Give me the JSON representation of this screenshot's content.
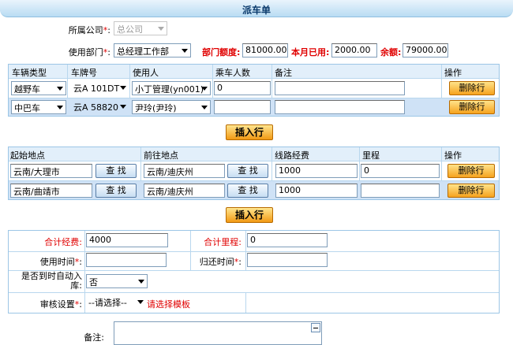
{
  "title": "派车单",
  "header": {
    "company_label": "所属公司",
    "company_value": "总公司",
    "dept_label": "使用部门",
    "dept_value": "总经理工作部",
    "quota_label": "部门额度:",
    "quota_value": "81000.00",
    "used_label": "本月已用:",
    "used_value": "2000.00",
    "balance_label": "余额:",
    "balance_value": "79000.00",
    "required_mark": "*",
    "colon": ":"
  },
  "vehicle_table": {
    "columns": [
      "车辆类型",
      "车牌号",
      "使用人",
      "乘车人数",
      "备注",
      "操作"
    ],
    "rows": [
      {
        "type": "越野车",
        "plate": "云A 101DT",
        "user": "小丁管理(yn001)",
        "passengers": "0",
        "remark": "",
        "action": "删除行"
      },
      {
        "type": "中巴车",
        "plate": "云A 58820",
        "user": "尹玲(尹玲)",
        "passengers": "",
        "remark": "",
        "action": "删除行"
      }
    ],
    "insert_label": "插入行"
  },
  "route_table": {
    "columns": [
      "起始地点",
      "前往地点",
      "线路经费",
      "里程",
      "操作"
    ],
    "rows": [
      {
        "start": "云南/大理市",
        "dest": "云南/迪庆州",
        "fee": "1000",
        "mileage": "0",
        "action": "删除行"
      },
      {
        "start": "云南/曲靖市",
        "dest": "云南/迪庆州",
        "fee": "1000",
        "mileage": "",
        "action": "删除行"
      }
    ],
    "find_label": "查 找",
    "insert_label": "插入行"
  },
  "summary": {
    "total_fee_label": "合计经费:",
    "total_fee_value": "4000",
    "total_mileage_label": "合计里程:",
    "total_mileage_value": "0",
    "use_time_label": "使用时间",
    "return_time_label": "归还时间",
    "auto_store_label_1": "是否到时自动入",
    "auto_store_label_2": "库:",
    "auto_store_value": "否",
    "audit_label": "审核设置",
    "audit_value": "--请选择--",
    "audit_hint": "请选择模板",
    "remark_label": "备注:"
  },
  "colors": {
    "accent_orange": "#f6a31e",
    "header_blue": "#e2effa",
    "required_red": "#e00000"
  }
}
